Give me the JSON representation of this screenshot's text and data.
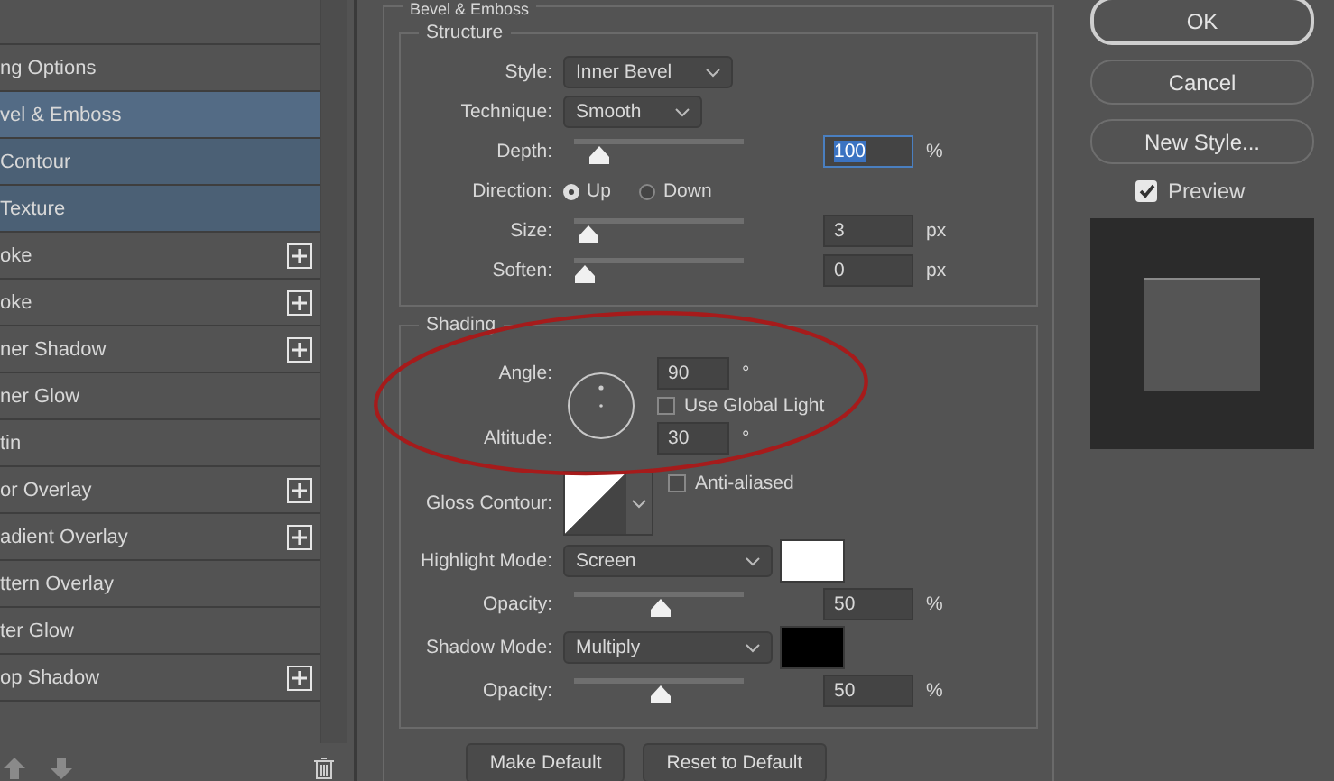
{
  "layer_styles": {
    "items": [
      {
        "label": "ng Options",
        "active": false,
        "selected": false,
        "add_button": false
      },
      {
        "label": "vel & Emboss",
        "active": true,
        "selected": true,
        "add_button": false
      },
      {
        "label": "Contour",
        "active": true,
        "selected": false,
        "add_button": false
      },
      {
        "label": "Texture",
        "active": true,
        "selected": false,
        "add_button": false
      },
      {
        "label": "oke",
        "active": false,
        "selected": false,
        "add_button": true
      },
      {
        "label": "oke",
        "active": false,
        "selected": false,
        "add_button": true
      },
      {
        "label": "ner Shadow",
        "active": false,
        "selected": false,
        "add_button": true
      },
      {
        "label": "ner Glow",
        "active": false,
        "selected": false,
        "add_button": false
      },
      {
        "label": "tin",
        "active": false,
        "selected": false,
        "add_button": false
      },
      {
        "label": "or Overlay",
        "active": false,
        "selected": false,
        "add_button": true
      },
      {
        "label": "adient Overlay",
        "active": false,
        "selected": false,
        "add_button": true
      },
      {
        "label": "ttern Overlay",
        "active": false,
        "selected": false,
        "add_button": false
      },
      {
        "label": "ter Glow",
        "active": false,
        "selected": false,
        "add_button": false
      },
      {
        "label": "op Shadow",
        "active": false,
        "selected": false,
        "add_button": true
      }
    ]
  },
  "bevel_emboss": {
    "title": "Bevel & Emboss",
    "structure": {
      "title": "Structure",
      "rows": [
        {
          "kind": "select",
          "label": "Style:",
          "value": "Inner Bevel",
          "wide": true
        },
        {
          "kind": "select",
          "label": "Technique:",
          "value": "Smooth",
          "wide": false
        },
        {
          "kind": "slider",
          "label": "Depth:",
          "level": 0.1,
          "value": "100",
          "unit": "%",
          "focused": true
        },
        {
          "kind": "radio",
          "label": "Direction:",
          "options": [
            {
              "label": "Up",
              "selected": true
            },
            {
              "label": "Down",
              "selected": false
            }
          ]
        },
        {
          "kind": "slider",
          "label": "Size:",
          "level": 0.02,
          "value": "3",
          "unit": "px",
          "focused": false
        },
        {
          "kind": "slider",
          "label": "Soften:",
          "level": 0,
          "value": "0",
          "unit": "px",
          "focused": false
        }
      ]
    },
    "shading": {
      "title": "Shading",
      "angle": {
        "label": "Angle:",
        "value": "90",
        "unit": "°"
      },
      "use_global_light": {
        "label": "Use Global Light",
        "checked": false
      },
      "altitude": {
        "label": "Altitude:",
        "value": "30",
        "unit": "°"
      },
      "gloss_contour": {
        "label": "Gloss Contour:"
      },
      "anti_aliased": {
        "label": "Anti-aliased",
        "checked": false
      },
      "rows": [
        {
          "kind": "mode",
          "label": "Highlight Mode:",
          "value": "Screen",
          "color": "#ffffff"
        },
        {
          "kind": "slider",
          "label": "Opacity:",
          "level": 0.5,
          "value": "50",
          "unit": "%",
          "focused": false
        },
        {
          "kind": "mode",
          "label": "Shadow Mode:",
          "value": "Multiply",
          "color": "#000000"
        },
        {
          "kind": "slider",
          "label": "Opacity:",
          "level": 0.5,
          "value": "50",
          "unit": "%",
          "focused": false
        }
      ]
    },
    "buttons": [
      {
        "label": "Make Default"
      },
      {
        "label": "Reset to Default"
      }
    ]
  },
  "actions": [
    {
      "label": "OK",
      "default": true
    },
    {
      "label": "Cancel",
      "default": false
    },
    {
      "label": "New Style...",
      "default": false
    }
  ],
  "preview": {
    "label": "Preview",
    "checked": true
  },
  "annotation": {
    "kind": "ellipse"
  }
}
